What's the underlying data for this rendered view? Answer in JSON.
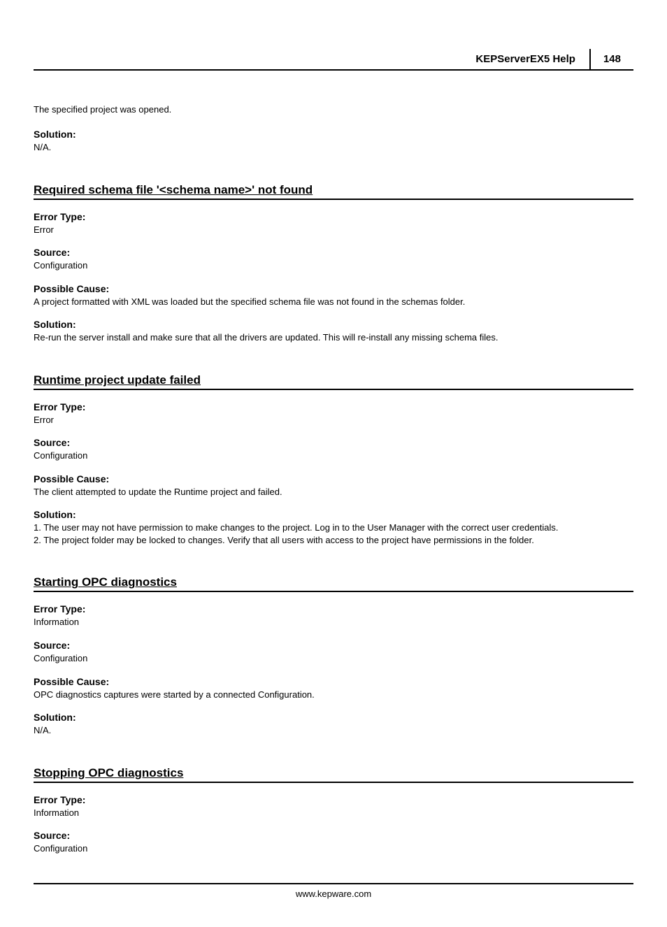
{
  "header": {
    "title": "KEPServerEX5 Help",
    "page": "148"
  },
  "intro": "The specified project was opened.",
  "intro_solution_label": "Solution:",
  "intro_solution_value": "N/A.",
  "labels": {
    "error_type": "Error Type:",
    "source": "Source:",
    "possible_cause": "Possible Cause:",
    "solution": "Solution:"
  },
  "sections": [
    {
      "heading": "Required schema file '<schema name>' not found",
      "error_type": "Error",
      "source": "Configuration",
      "possible_cause": "A project formatted with XML was loaded but the specified schema file was not found in the schemas folder.",
      "solution": "Re-run the server install and make sure that all the drivers are updated. This will re-install any missing schema files."
    },
    {
      "heading": "Runtime project update failed",
      "error_type": "Error",
      "source": "Configuration",
      "possible_cause": "The client attempted to update the Runtime project and failed.",
      "solution": "1. The user may not have permission to make changes to the project. Log in to the User Manager with the correct user credentials.\n2. The project folder may be locked to changes. Verify that all users with access to the project have permissions in the folder."
    },
    {
      "heading": "Starting OPC diagnostics",
      "error_type": "Information",
      "source": "Configuration",
      "possible_cause": "OPC diagnostics captures were started by a connected Configuration.",
      "solution": "N/A."
    },
    {
      "heading": "Stopping OPC diagnostics",
      "error_type": "Information",
      "source": "Configuration",
      "possible_cause": "",
      "solution": ""
    }
  ],
  "footer": "www.kepware.com"
}
